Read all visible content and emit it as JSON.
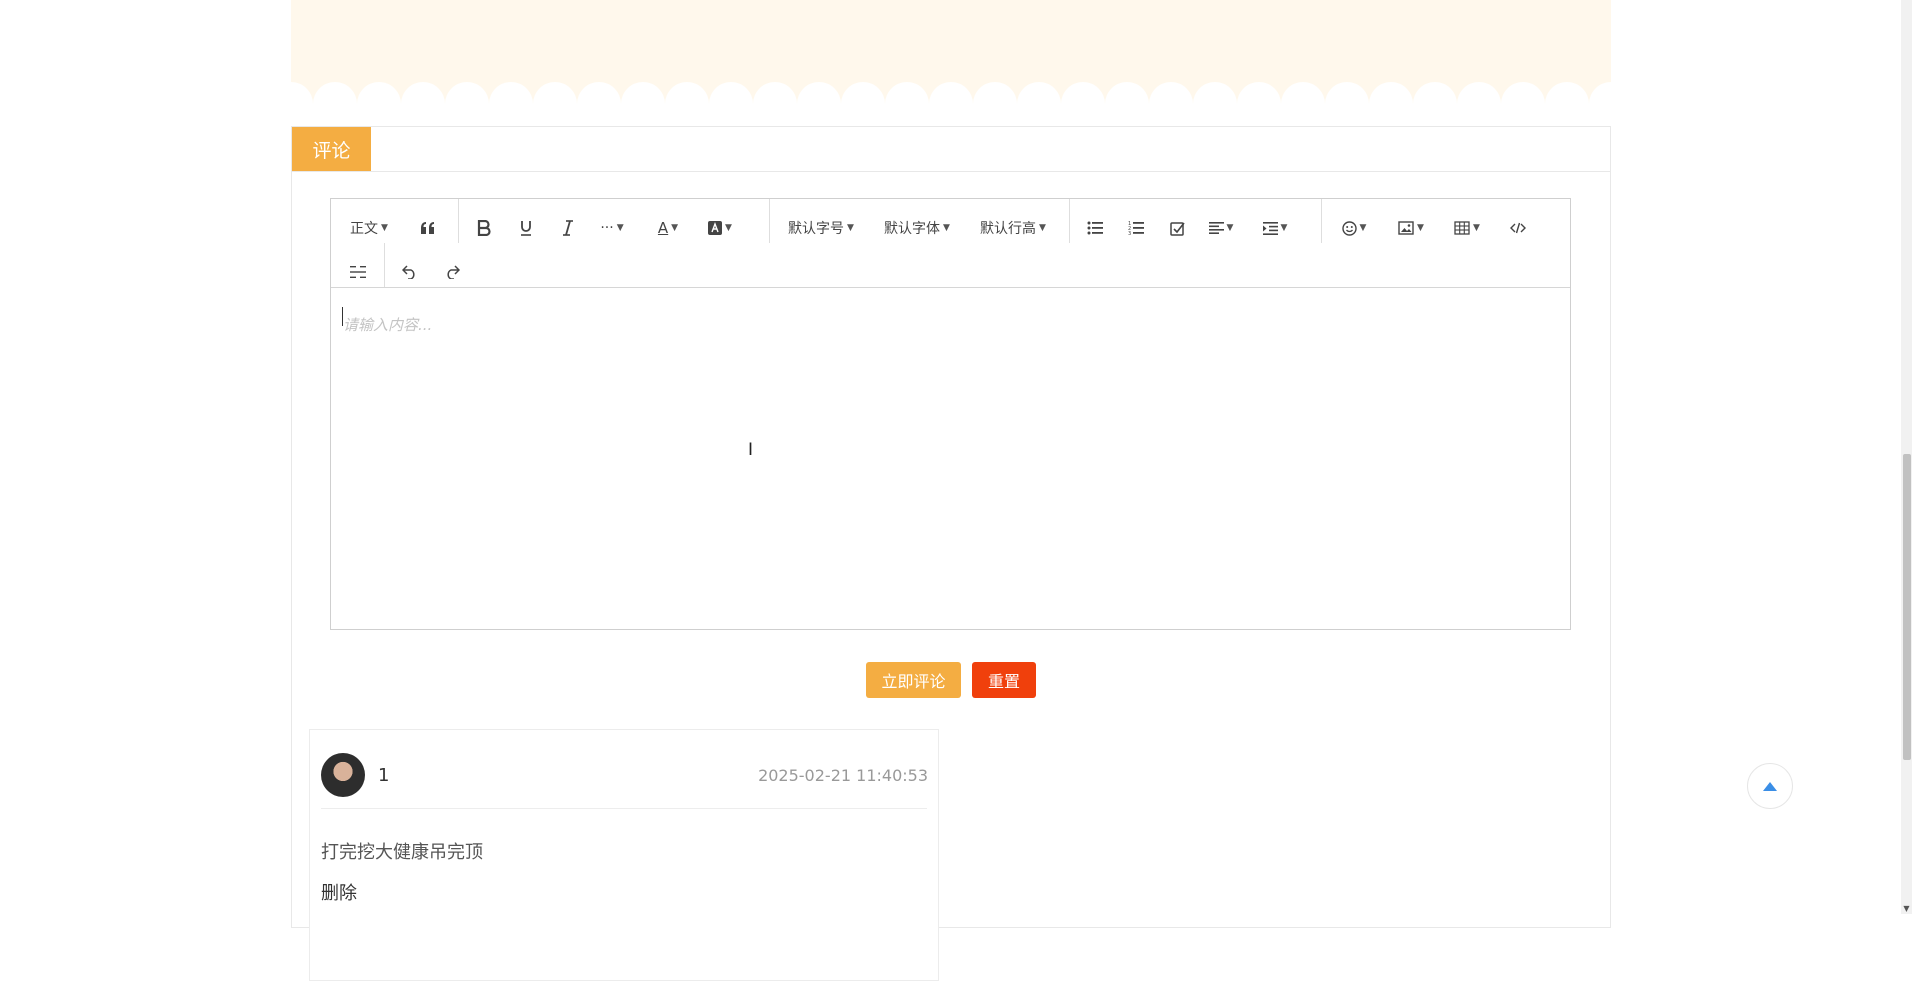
{
  "section": {
    "tab_label": "评论"
  },
  "editor": {
    "toolbar": {
      "paragraph_label": "正文",
      "font_size_label": "默认字号",
      "font_family_label": "默认字体",
      "line_height_label": "默认行高",
      "more_label": "···",
      "font_color_label": "A"
    },
    "placeholder": "请输入内容..."
  },
  "actions": {
    "submit_label": "立即评论",
    "reset_label": "重置"
  },
  "comments": [
    {
      "user": "1",
      "timestamp": "2025-02-21 11:40:53",
      "content": "打完挖大健康吊完顶",
      "delete_label": "删除"
    }
  ],
  "colors": {
    "accent": "#f4ad42",
    "danger": "#f0400c",
    "banner": "#fff8ec"
  }
}
